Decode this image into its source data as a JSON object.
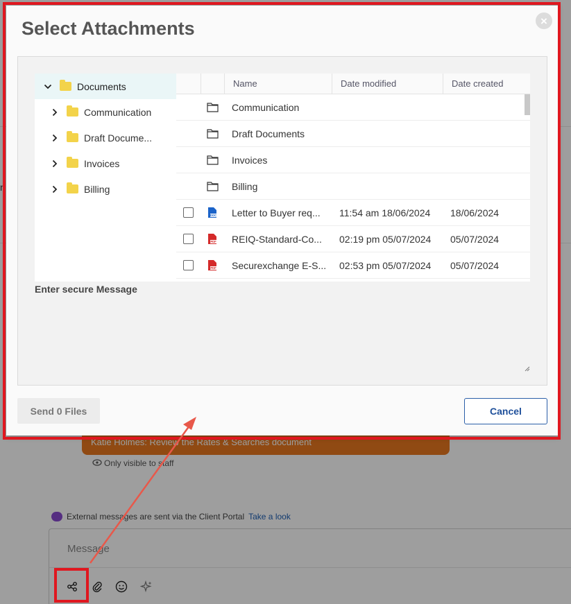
{
  "modal": {
    "title": "Select Attachments",
    "close_label": "×",
    "tree": {
      "root": "Documents",
      "children": [
        "Communication",
        "Draft Docume...",
        "Invoices",
        "Billing"
      ]
    },
    "grid": {
      "headers": {
        "name": "Name",
        "modified": "Date modified",
        "created": "Date created"
      },
      "rows": [
        {
          "type": "folder",
          "name": "Communication",
          "modified": "",
          "created": ""
        },
        {
          "type": "folder",
          "name": "Draft Documents",
          "modified": "",
          "created": ""
        },
        {
          "type": "folder",
          "name": "Invoices",
          "modified": "",
          "created": ""
        },
        {
          "type": "folder",
          "name": "Billing",
          "modified": "",
          "created": ""
        },
        {
          "type": "doc",
          "name": "Letter to Buyer req...",
          "modified": "11:54 am 18/06/2024",
          "created": "18/06/2024"
        },
        {
          "type": "pdf",
          "name": "REIQ-Standard-Co...",
          "modified": "02:19 pm 05/07/2024",
          "created": "05/07/2024"
        },
        {
          "type": "pdf",
          "name": "Securexchange E-S...",
          "modified": "02:53 pm 05/07/2024",
          "created": "05/07/2024"
        }
      ]
    },
    "message_label": "Enter secure Message",
    "send_label": "Send 0 Files",
    "cancel_label": "Cancel"
  },
  "background": {
    "edge_char": "n",
    "task_text": "Katie Holmes: Review the Rates & Searches document",
    "visible_note": "Only visible to staff",
    "external_note": "External messages are sent via the Client Portal",
    "external_link": "Take a look",
    "composer_placeholder": "Message"
  },
  "colors": {
    "annotation": "#e0171f",
    "arrow": "#e8584a",
    "folder": "#f3d34a",
    "accent": "#1e4f9a",
    "task": "#e8781f"
  },
  "icons": [
    "close-icon",
    "chevron-down-icon",
    "chevron-right-icon",
    "folder-icon",
    "folder-outline-icon",
    "doc-file-icon",
    "pdf-file-icon",
    "share-icon",
    "paperclip-icon",
    "emoji-icon",
    "sparkle-icon",
    "eye-icon"
  ]
}
